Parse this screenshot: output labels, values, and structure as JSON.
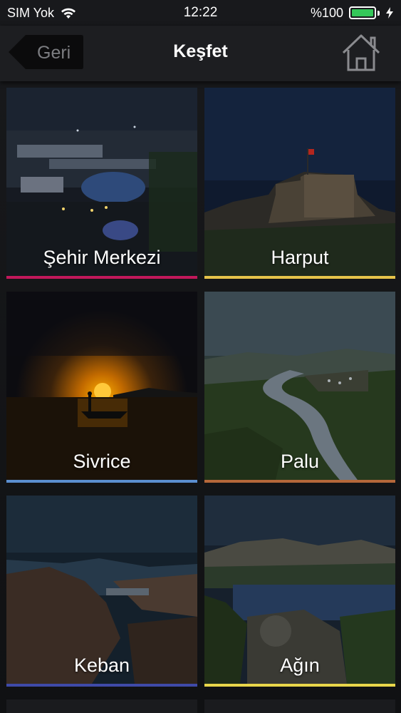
{
  "status_bar": {
    "carrier": "SIM Yok",
    "time": "12:22",
    "battery_text": "%100",
    "battery_color": "#34c759"
  },
  "nav": {
    "back_label": "Geri",
    "title": "Keşfet",
    "home_icon": "home-icon"
  },
  "tiles": [
    {
      "label": "Şehir Merkezi",
      "accent": "#c2185b"
    },
    {
      "label": "Harput",
      "accent": "#e6c44a"
    },
    {
      "label": "Sivrice",
      "accent": "#5b8fd0"
    },
    {
      "label": "Palu",
      "accent": "#b5683a"
    },
    {
      "label": "Keban",
      "accent": "#3f4aa8"
    },
    {
      "label": "Ağın",
      "accent": "#e8d64a"
    }
  ]
}
